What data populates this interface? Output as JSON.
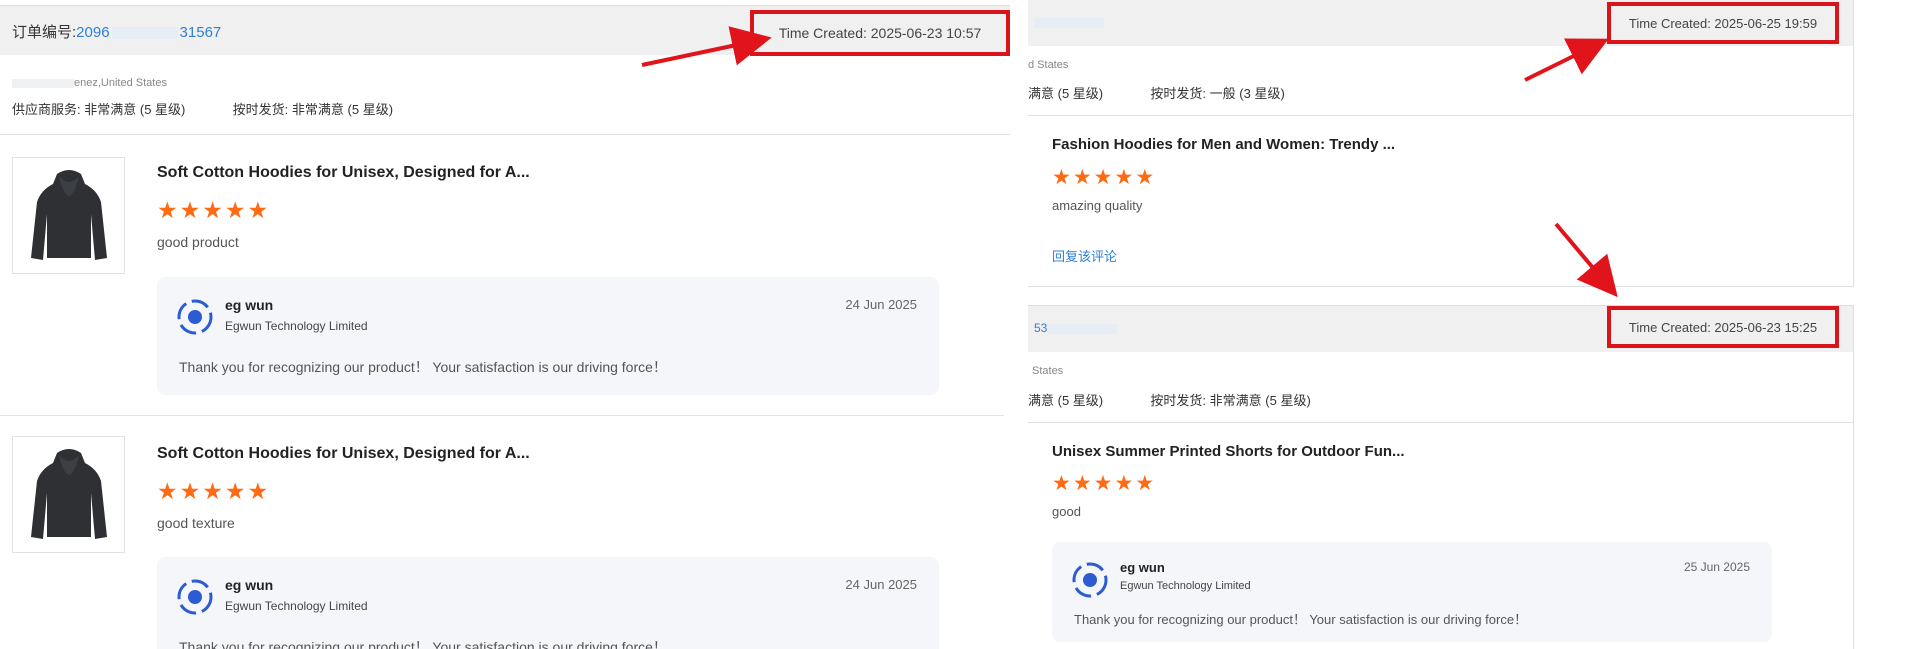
{
  "left_card": {
    "order_label": "订单编号:",
    "order_prefix": "2096",
    "order_suffix": "31567",
    "time_created": "Time Created: 2025-06-23 10:57",
    "customer_location": "enez,United States",
    "supplier_service_label": "供应商服务:",
    "supplier_service_value": "非常满意",
    "supplier_service_stars": "(5 星级)",
    "ontime_label": "按时发货:",
    "ontime_value": "非常满意",
    "ontime_stars": "(5 星级)",
    "reviews": [
      {
        "title": "Soft Cotton Hoodies for Unisex, Designed for A...",
        "rating": 5,
        "text": "good product",
        "reply": {
          "name": "eg wun",
          "company": "Egwun Technology Limited",
          "date": "24 Jun 2025",
          "text": "Thank you for recognizing our product！ Your satisfaction is our driving force！"
        }
      },
      {
        "title": "Soft Cotton Hoodies for Unisex, Designed for A...",
        "rating": 5,
        "text": "good texture",
        "reply": {
          "name": "eg wun",
          "company": "Egwun Technology Limited",
          "date": "24 Jun 2025",
          "text": "Thank you for recognizing our product！ Your satisfaction is our driving force！"
        }
      }
    ]
  },
  "right_top_card": {
    "time_created": "Time Created: 2025-06-25 19:59",
    "customer_location": "d States",
    "supplier_service_value": "满意",
    "supplier_service_stars": "(5 星级)",
    "ontime_label": "按时发货:",
    "ontime_value": "一般",
    "ontime_stars": "(3 星级)",
    "review": {
      "title": "Fashion Hoodies for Men and Women: Trendy ...",
      "rating": 5,
      "text": "amazing quality",
      "reply_link": "回复该评论"
    }
  },
  "right_bottom_card": {
    "order_prefix": "53",
    "time_created": "Time Created: 2025-06-23 15:25",
    "customer_location": "States",
    "supplier_service_value": "满意",
    "supplier_service_stars": "(5 星级)",
    "ontime_label": "按时发货:",
    "ontime_value": "非常满意",
    "ontime_stars": "(5 星级)",
    "review": {
      "title": "Unisex Summer Printed Shorts for Outdoor Fun...",
      "rating": 5,
      "text": "good",
      "reply": {
        "name": "eg wun",
        "company": "Egwun Technology Limited",
        "date": "25 Jun 2025",
        "text": "Thank you for recognizing our product！ Your satisfaction is our driving force！"
      }
    }
  },
  "colors": {
    "highlight_red": "#d9151b",
    "star_orange": "#ff6a13",
    "link_blue": "#2f7fd6",
    "header_gray": "#f0f0f0",
    "reply_bg": "#f5f6f9"
  },
  "icons": {
    "rating": "star-icon",
    "avatar": "seller-avatar-icon",
    "thumbnail": "hoodie-product-image",
    "annotation": "red-arrow-annotation"
  }
}
